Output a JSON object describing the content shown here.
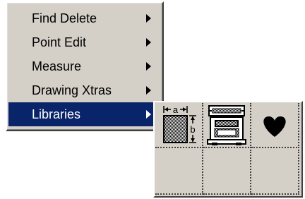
{
  "menu": {
    "items": [
      {
        "label": "Find Delete",
        "has_submenu": true,
        "active": false
      },
      {
        "label": "Point Edit",
        "has_submenu": true,
        "active": false
      },
      {
        "label": "Measure",
        "has_submenu": true,
        "active": false
      },
      {
        "label": "Drawing Xtras",
        "has_submenu": true,
        "active": false
      },
      {
        "label": "Libraries",
        "has_submenu": true,
        "active": true
      }
    ],
    "highlight_color": "#0a246a",
    "face_color": "#d4d0c8"
  },
  "palette": {
    "cells": [
      {
        "icon": "dimensioned-rectangle-icon",
        "dim_a": "a",
        "dim_b": "b"
      },
      {
        "icon": "machine-part-icon"
      },
      {
        "icon": "heart-icon"
      },
      {
        "icon": "empty"
      },
      {
        "icon": "empty"
      },
      {
        "icon": "empty"
      }
    ]
  }
}
